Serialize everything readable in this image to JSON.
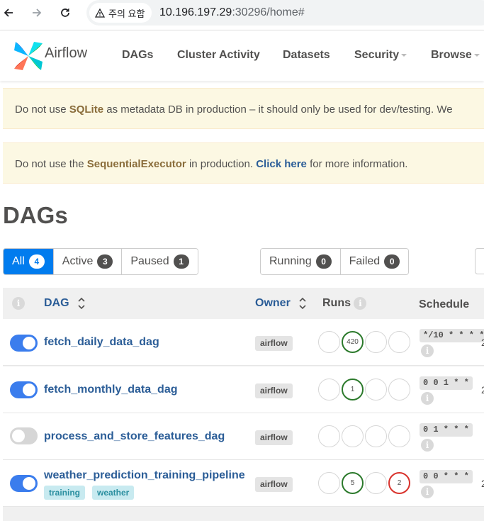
{
  "browser": {
    "security_label": "주의 요함",
    "url_host": "10.196.197.29",
    "url_rest": ":30296/home#"
  },
  "nav": {
    "brand": "Airflow",
    "links": [
      "DAGs",
      "Cluster Activity",
      "Datasets",
      "Security",
      "Browse"
    ]
  },
  "alerts": {
    "sqlite": {
      "pre": "Do not use ",
      "strong": "SQLite",
      "post": " as metadata DB in production – it should only be used for dev/testing. We"
    },
    "executor": {
      "pre": "Do not use the ",
      "strong": "SequentialExecutor",
      "mid": " in production. ",
      "link": "Click here",
      "post": " for more information."
    }
  },
  "page_title": "DAGs",
  "filters": {
    "status": [
      {
        "label": "All",
        "count": "4"
      },
      {
        "label": "Active",
        "count": "3"
      },
      {
        "label": "Paused",
        "count": "1"
      }
    ],
    "runs": [
      {
        "label": "Running",
        "count": "0"
      },
      {
        "label": "Failed",
        "count": "0"
      }
    ]
  },
  "table": {
    "headers": {
      "info": "i",
      "dag": "DAG",
      "owner": "Owner",
      "runs": "Runs",
      "schedule": "Schedule"
    },
    "rows": [
      {
        "name": "fetch_daily_data_dag",
        "active": true,
        "owner": "airflow",
        "runs": [
          "",
          "420",
          "",
          ""
        ],
        "schedule": "*/10 * * * *",
        "tags": [],
        "next": "2"
      },
      {
        "name": "fetch_monthly_data_dag",
        "active": true,
        "owner": "airflow",
        "runs": [
          "",
          "1",
          "",
          ""
        ],
        "schedule": "0 0 1 * *",
        "tags": [],
        "next": "2"
      },
      {
        "name": "process_and_store_features_dag",
        "active": false,
        "owner": "airflow",
        "runs": [
          "",
          "",
          "",
          ""
        ],
        "schedule": "0 1 * * *",
        "tags": [],
        "next": ""
      },
      {
        "name": "weather_prediction_training_pipeline",
        "active": true,
        "owner": "airflow",
        "runs": [
          "",
          "5",
          "",
          "2"
        ],
        "schedule": "0 0 * * *",
        "tags": [
          "training",
          "weather"
        ],
        "next": "2"
      }
    ]
  },
  "colors": {
    "accent": "#017cee",
    "link": "#2b5d97",
    "success": "#2c7a2c",
    "failed": "#d9332d",
    "alert_bg": "#fcf8e3"
  }
}
